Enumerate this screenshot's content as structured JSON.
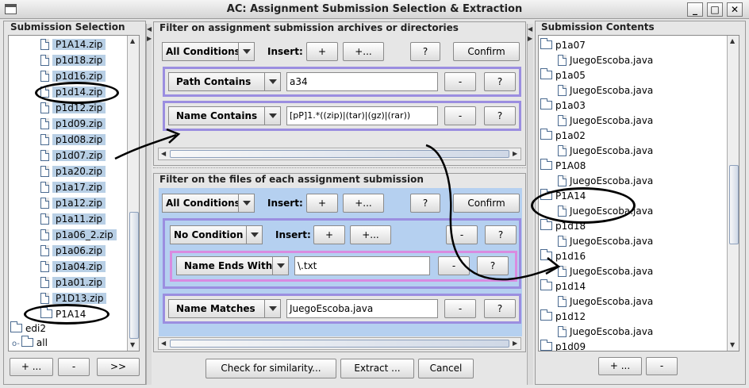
{
  "window": {
    "title": "AC: Assignment Submission Selection & Extraction",
    "minimize": "_",
    "maximize": "□",
    "close": "✕"
  },
  "left": {
    "title": "Submission Selection",
    "items": [
      "P1A14.zip",
      "p1d18.zip",
      "p1d16.zip",
      "p1d14.zip",
      "p1d12.zip",
      "p1d09.zip",
      "p1d08.zip",
      "p1d07.zip",
      "p1a20.zip",
      "p1a17.zip",
      "p1a12.zip",
      "p1a11.zip",
      "p1a06_2.zip",
      "p1a06.zip",
      "p1a04.zip",
      "p1a01.zip",
      "P1D13.zip"
    ],
    "folder_selected": "P1A14",
    "folder_edi2": "edi2",
    "folder_all": "all",
    "buttons": {
      "add": "+ ...",
      "remove": "-",
      "next": ">>"
    }
  },
  "archives": {
    "title": "Filter on assignment submission archives or directories",
    "mode": "All Conditions",
    "insert_label": "Insert:",
    "add": "+",
    "add_more": "+...",
    "help": "?",
    "confirm": "Confirm",
    "conditions": [
      {
        "type": "Path Contains",
        "value": "a34",
        "remove": "-",
        "help": "?"
      },
      {
        "type": "Name Contains",
        "value": "[pP]1.*((zip)|(tar)|(gz)|(rar))",
        "remove": "-",
        "help": "?"
      }
    ]
  },
  "files": {
    "title": "Filter on the files of each assignment submission",
    "mode": "All Conditions",
    "insert_label": "Insert:",
    "add": "+",
    "add_more": "+...",
    "help": "?",
    "confirm": "Confirm",
    "nested": {
      "mode": "No Condition",
      "insert_label": "Insert:",
      "add": "+",
      "add_more": "+...",
      "remove": "-",
      "help": "?",
      "condition": {
        "type": "Name Ends With",
        "value": "\\.txt",
        "remove": "-",
        "help": "?"
      }
    },
    "match": {
      "type": "Name Matches",
      "value": "JuegoEscoba.java",
      "remove": "-",
      "help": "?"
    }
  },
  "actions": {
    "similarity": "Check for similarity...",
    "extract": "Extract ...",
    "cancel": "Cancel"
  },
  "right": {
    "title": "Submission Contents",
    "entries": [
      {
        "folder": "p1a07",
        "file": "JuegoEscoba.java"
      },
      {
        "folder": "p1a05",
        "file": "JuegoEscoba.java"
      },
      {
        "folder": "p1a03",
        "file": "JuegoEscoba.java"
      },
      {
        "folder": "p1a02",
        "file": "JuegoEscoba.java"
      },
      {
        "folder": "P1A08",
        "file": "JuegoEscoba.java"
      },
      {
        "folder": "P1A14",
        "file": "JuegoEscoba.java"
      },
      {
        "folder": "p1d18",
        "file": "JuegoEscoba.java"
      },
      {
        "folder": "p1d16",
        "file": "JuegoEscoba.java"
      },
      {
        "folder": "p1d14",
        "file": "JuegoEscoba.java"
      },
      {
        "folder": "p1d12",
        "file": "JuegoEscoba.java"
      },
      {
        "folder": "p1d09",
        "file": ""
      }
    ],
    "buttons": {
      "add": "+ ...",
      "remove": "-"
    }
  },
  "colors": {
    "selection": "#b8cfe5",
    "condition_border": "#9b8ee0",
    "nested_border": "#d98be0",
    "files_bg": "#b5d0f0"
  }
}
